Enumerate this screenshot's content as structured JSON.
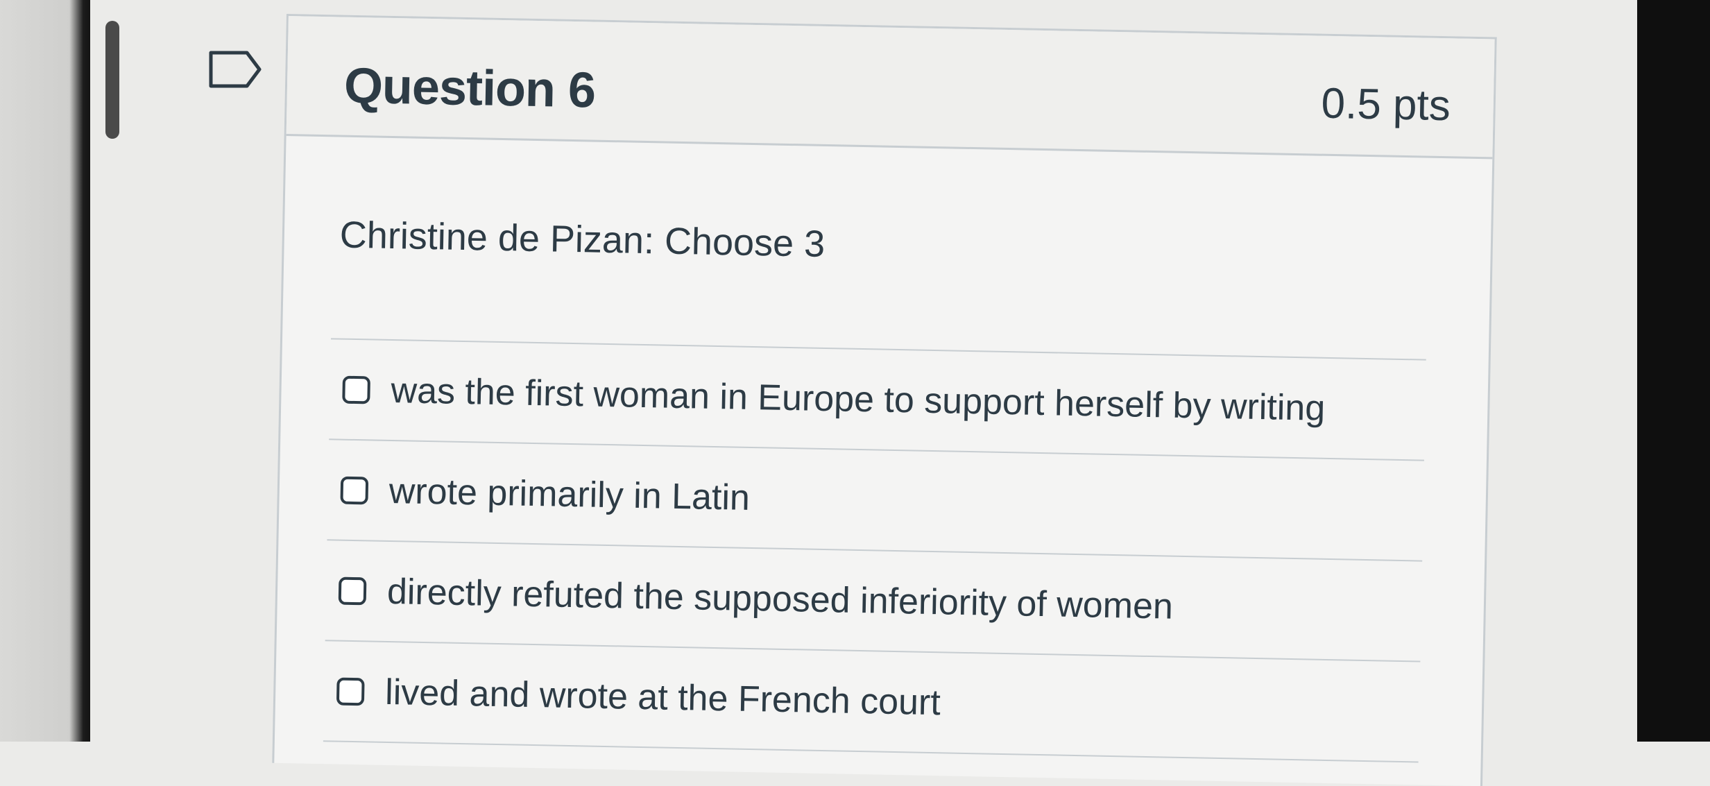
{
  "question": {
    "title": "Question 6",
    "points": "0.5 pts",
    "prompt": "Christine de Pizan: Choose 3",
    "answers": [
      {
        "label": "was the first woman in Europe to support herself by writing",
        "checked": false
      },
      {
        "label": "wrote primarily in Latin",
        "checked": false
      },
      {
        "label": "directly refuted the supposed inferiority of women",
        "checked": false
      },
      {
        "label": "lived and wrote at the French court",
        "checked": false
      }
    ]
  },
  "icons": {
    "flag": "flag-icon"
  },
  "colors": {
    "text": "#2d3b45",
    "border": "#c7cdd1",
    "card_background": "#f4f4f3"
  }
}
